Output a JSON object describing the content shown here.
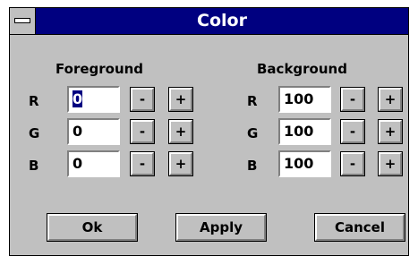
{
  "window": {
    "title": "Color"
  },
  "foreground": {
    "label": "Foreground",
    "rows": [
      {
        "label": "R",
        "value": "0",
        "minus": "-",
        "plus": "+"
      },
      {
        "label": "G",
        "value": "0",
        "minus": "-",
        "plus": "+"
      },
      {
        "label": "B",
        "value": "0",
        "minus": "-",
        "plus": "+"
      }
    ]
  },
  "background": {
    "label": "Background",
    "rows": [
      {
        "label": "R",
        "value": "100",
        "minus": "-",
        "plus": "+"
      },
      {
        "label": "G",
        "value": "100",
        "minus": "-",
        "plus": "+"
      },
      {
        "label": "B",
        "value": "100",
        "minus": "-",
        "plus": "+"
      }
    ]
  },
  "buttons": {
    "ok": "Ok",
    "apply": "Apply",
    "cancel": "Cancel"
  }
}
